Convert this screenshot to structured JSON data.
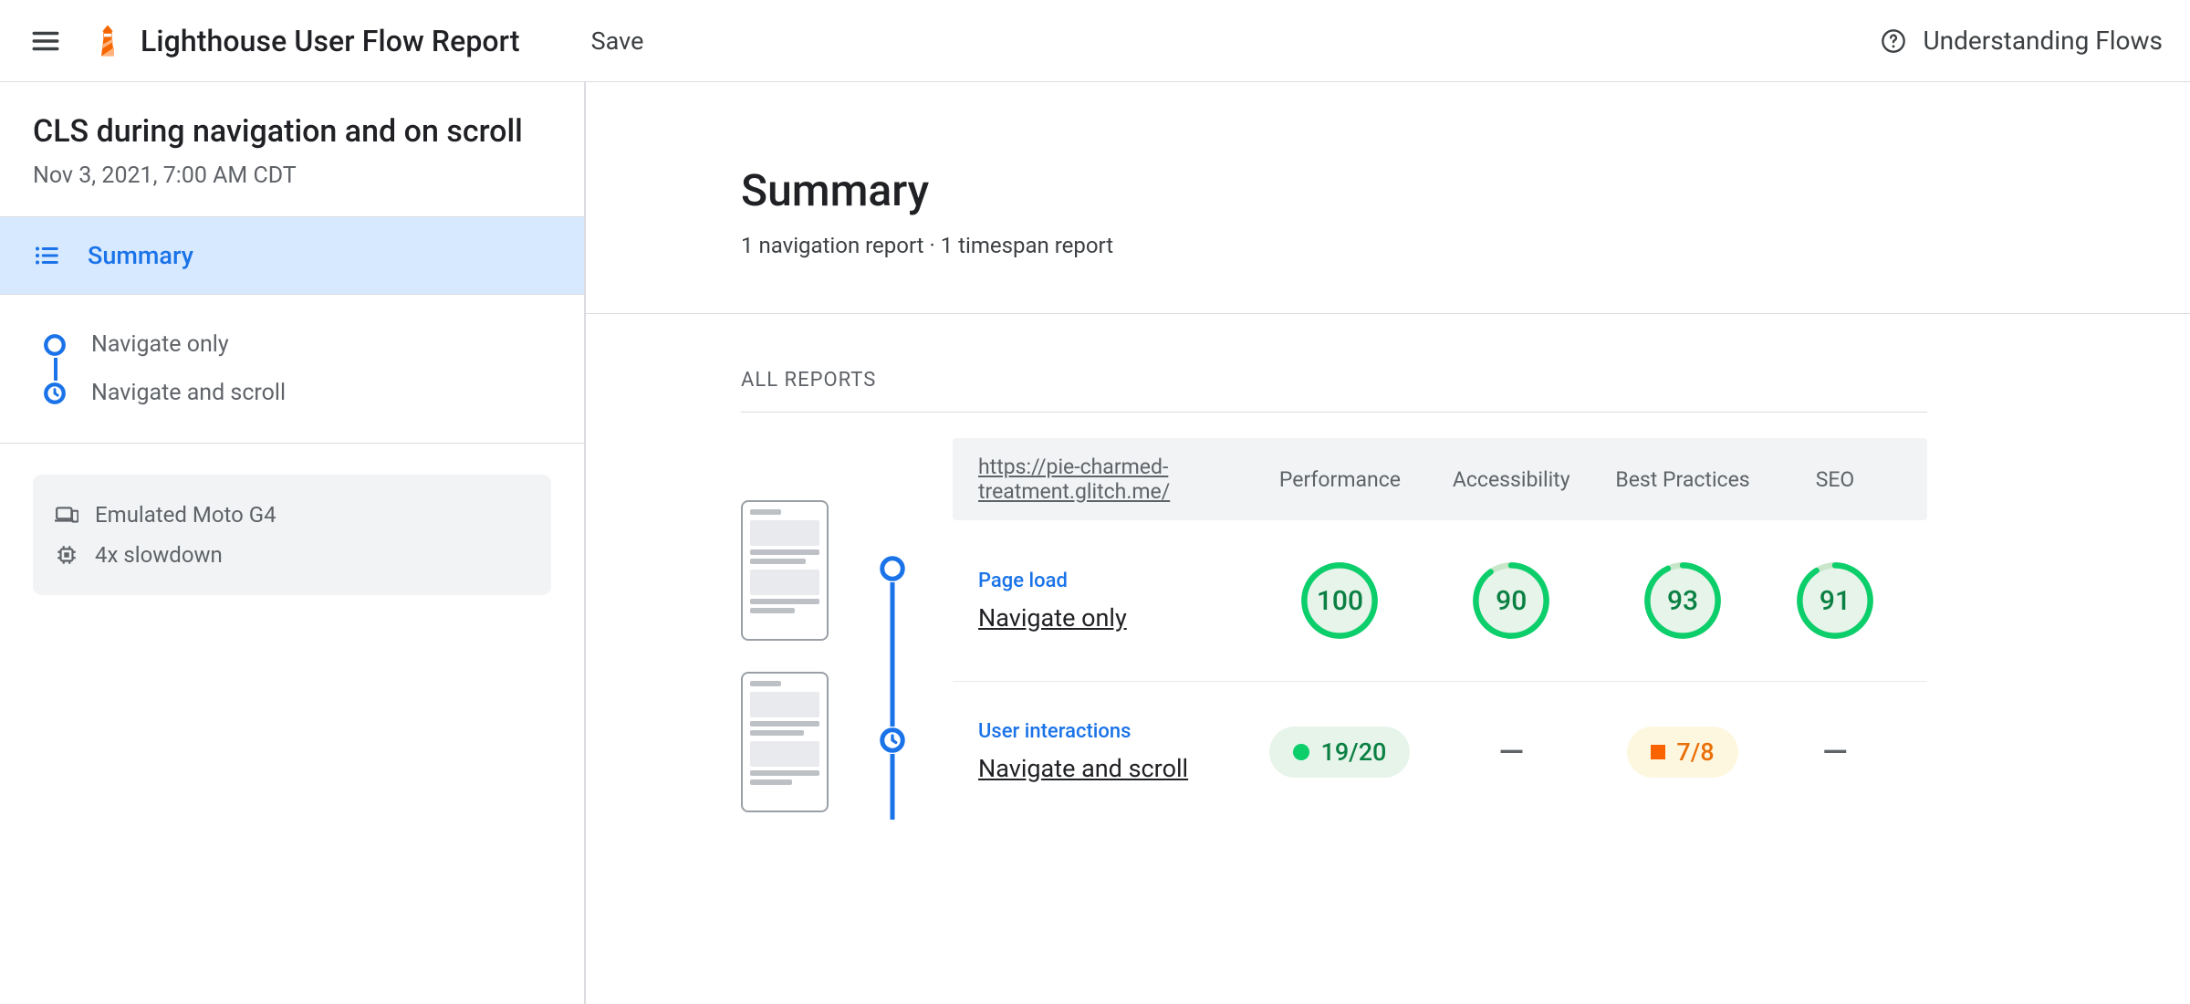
{
  "header": {
    "app_title": "Lighthouse User Flow Report",
    "save": "Save",
    "help": "Understanding Flows"
  },
  "sidebar": {
    "flow_title": "CLS during navigation and on scroll",
    "flow_date": "Nov 3, 2021, 7:00 AM CDT",
    "summary_label": "Summary",
    "steps": [
      {
        "label": "Navigate only",
        "marker": "circle"
      },
      {
        "label": "Navigate and scroll",
        "marker": "clock"
      }
    ],
    "env": {
      "device": "Emulated Moto G4",
      "cpu": "4x slowdown"
    }
  },
  "main": {
    "title": "Summary",
    "subtitle": "1 navigation report · 1 timespan report",
    "section_label": "ALL REPORTS",
    "columns": {
      "url": "https://pie-charmed-treatment.glitch.me/",
      "perf": "Performance",
      "a11y": "Accessibility",
      "bp": "Best Practices",
      "seo": "SEO"
    },
    "rows": [
      {
        "kind": "Page load",
        "name": "Navigate only",
        "marker": "circle",
        "scores": {
          "perf": 100,
          "a11y": 90,
          "bp": 93,
          "seo": 91
        }
      },
      {
        "kind": "User interactions",
        "name": "Navigate and scroll",
        "marker": "clock",
        "perf_fraction": "19/20",
        "bp_fraction": "7/8"
      }
    ]
  }
}
